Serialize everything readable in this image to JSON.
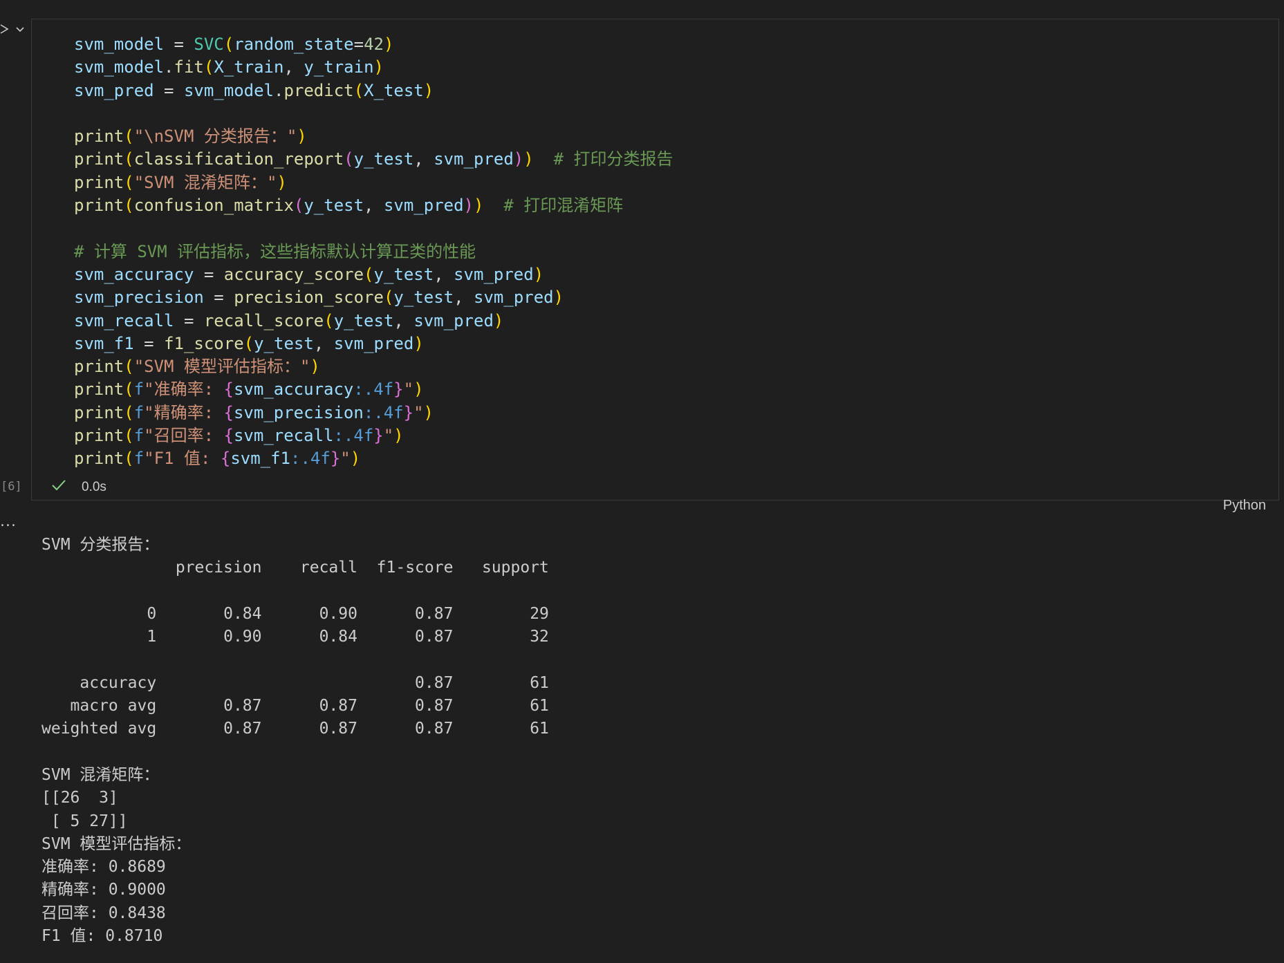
{
  "cell": {
    "execution_count": "[6]",
    "exec_time": "0.0s",
    "language": "Python",
    "code_lines": [
      [
        {
          "t": "svm_model",
          "c": "v"
        },
        {
          "t": " = "
        },
        {
          "t": "SVC",
          "c": "c"
        },
        {
          "t": "(",
          "c": "b1"
        },
        {
          "t": "random_state",
          "c": "v"
        },
        {
          "t": "="
        },
        {
          "t": "42",
          "c": "n"
        },
        {
          "t": ")",
          "c": "b1"
        }
      ],
      [
        {
          "t": "svm_model",
          "c": "v"
        },
        {
          "t": "."
        },
        {
          "t": "fit",
          "c": "f"
        },
        {
          "t": "(",
          "c": "b1"
        },
        {
          "t": "X_train",
          "c": "v"
        },
        {
          "t": ", "
        },
        {
          "t": "y_train",
          "c": "v"
        },
        {
          "t": ")",
          "c": "b1"
        }
      ],
      [
        {
          "t": "svm_pred",
          "c": "v"
        },
        {
          "t": " = "
        },
        {
          "t": "svm_model",
          "c": "v"
        },
        {
          "t": "."
        },
        {
          "t": "predict",
          "c": "f"
        },
        {
          "t": "(",
          "c": "b1"
        },
        {
          "t": "X_test",
          "c": "v"
        },
        {
          "t": ")",
          "c": "b1"
        }
      ],
      [],
      [
        {
          "t": "print",
          "c": "f"
        },
        {
          "t": "(",
          "c": "b1"
        },
        {
          "t": "\"\\nSVM 分类报告：\"",
          "c": "s"
        },
        {
          "t": ")",
          "c": "b1"
        }
      ],
      [
        {
          "t": "print",
          "c": "f"
        },
        {
          "t": "(",
          "c": "b1"
        },
        {
          "t": "classification_report",
          "c": "f"
        },
        {
          "t": "(",
          "c": "b2"
        },
        {
          "t": "y_test",
          "c": "v"
        },
        {
          "t": ", "
        },
        {
          "t": "svm_pred",
          "c": "v"
        },
        {
          "t": ")",
          "c": "b2"
        },
        {
          "t": ")",
          "c": "b1"
        },
        {
          "t": "  "
        },
        {
          "t": "# 打印分类报告",
          "c": "cm"
        }
      ],
      [
        {
          "t": "print",
          "c": "f"
        },
        {
          "t": "(",
          "c": "b1"
        },
        {
          "t": "\"SVM 混淆矩阵：\"",
          "c": "s"
        },
        {
          "t": ")",
          "c": "b1"
        }
      ],
      [
        {
          "t": "print",
          "c": "f"
        },
        {
          "t": "(",
          "c": "b1"
        },
        {
          "t": "confusion_matrix",
          "c": "f"
        },
        {
          "t": "(",
          "c": "b2"
        },
        {
          "t": "y_test",
          "c": "v"
        },
        {
          "t": ", "
        },
        {
          "t": "svm_pred",
          "c": "v"
        },
        {
          "t": ")",
          "c": "b2"
        },
        {
          "t": ")",
          "c": "b1"
        },
        {
          "t": "  "
        },
        {
          "t": "# 打印混淆矩阵",
          "c": "cm"
        }
      ],
      [],
      [
        {
          "t": "# 计算 SVM 评估指标，这些指标默认计算正类的性能",
          "c": "cm"
        }
      ],
      [
        {
          "t": "svm_accuracy",
          "c": "v"
        },
        {
          "t": " = "
        },
        {
          "t": "accuracy_score",
          "c": "f"
        },
        {
          "t": "(",
          "c": "b1"
        },
        {
          "t": "y_test",
          "c": "v"
        },
        {
          "t": ", "
        },
        {
          "t": "svm_pred",
          "c": "v"
        },
        {
          "t": ")",
          "c": "b1"
        }
      ],
      [
        {
          "t": "svm_precision",
          "c": "v"
        },
        {
          "t": " = "
        },
        {
          "t": "precision_score",
          "c": "f"
        },
        {
          "t": "(",
          "c": "b1"
        },
        {
          "t": "y_test",
          "c": "v"
        },
        {
          "t": ", "
        },
        {
          "t": "svm_pred",
          "c": "v"
        },
        {
          "t": ")",
          "c": "b1"
        }
      ],
      [
        {
          "t": "svm_recall",
          "c": "v"
        },
        {
          "t": " = "
        },
        {
          "t": "recall_score",
          "c": "f"
        },
        {
          "t": "(",
          "c": "b1"
        },
        {
          "t": "y_test",
          "c": "v"
        },
        {
          "t": ", "
        },
        {
          "t": "svm_pred",
          "c": "v"
        },
        {
          "t": ")",
          "c": "b1"
        }
      ],
      [
        {
          "t": "svm_f1",
          "c": "v"
        },
        {
          "t": " = "
        },
        {
          "t": "f1_score",
          "c": "f"
        },
        {
          "t": "(",
          "c": "b1"
        },
        {
          "t": "y_test",
          "c": "v"
        },
        {
          "t": ", "
        },
        {
          "t": "svm_pred",
          "c": "v"
        },
        {
          "t": ")",
          "c": "b1"
        }
      ],
      [
        {
          "t": "print",
          "c": "f"
        },
        {
          "t": "(",
          "c": "b1"
        },
        {
          "t": "\"SVM 模型评估指标：\"",
          "c": "s"
        },
        {
          "t": ")",
          "c": "b1"
        }
      ],
      [
        {
          "t": "print",
          "c": "f"
        },
        {
          "t": "(",
          "c": "b1"
        },
        {
          "t": "f",
          "c": "k"
        },
        {
          "t": "\"准确率: ",
          "c": "s"
        },
        {
          "t": "{",
          "c": "b2"
        },
        {
          "t": "svm_accuracy",
          "c": "v"
        },
        {
          "t": ":.4f",
          "c": "k"
        },
        {
          "t": "}",
          "c": "b2"
        },
        {
          "t": "\"",
          "c": "s"
        },
        {
          "t": ")",
          "c": "b1"
        }
      ],
      [
        {
          "t": "print",
          "c": "f"
        },
        {
          "t": "(",
          "c": "b1"
        },
        {
          "t": "f",
          "c": "k"
        },
        {
          "t": "\"精确率: ",
          "c": "s"
        },
        {
          "t": "{",
          "c": "b2"
        },
        {
          "t": "svm_precision",
          "c": "v"
        },
        {
          "t": ":.4f",
          "c": "k"
        },
        {
          "t": "}",
          "c": "b2"
        },
        {
          "t": "\"",
          "c": "s"
        },
        {
          "t": ")",
          "c": "b1"
        }
      ],
      [
        {
          "t": "print",
          "c": "f"
        },
        {
          "t": "(",
          "c": "b1"
        },
        {
          "t": "f",
          "c": "k"
        },
        {
          "t": "\"召回率: ",
          "c": "s"
        },
        {
          "t": "{",
          "c": "b2"
        },
        {
          "t": "svm_recall",
          "c": "v"
        },
        {
          "t": ":.4f",
          "c": "k"
        },
        {
          "t": "}",
          "c": "b2"
        },
        {
          "t": "\"",
          "c": "s"
        },
        {
          "t": ")",
          "c": "b1"
        }
      ],
      [
        {
          "t": "print",
          "c": "f"
        },
        {
          "t": "(",
          "c": "b1"
        },
        {
          "t": "f",
          "c": "k"
        },
        {
          "t": "\"F1 值: ",
          "c": "s"
        },
        {
          "t": "{",
          "c": "b2"
        },
        {
          "t": "svm_f1",
          "c": "v"
        },
        {
          "t": ":.4f",
          "c": "k"
        },
        {
          "t": "}",
          "c": "b2"
        },
        {
          "t": "\"",
          "c": "s"
        },
        {
          "t": ")",
          "c": "b1"
        }
      ]
    ]
  },
  "output": {
    "more_label": "...",
    "lines": [
      "SVM 分类报告：",
      "              precision    recall  f1-score   support",
      "",
      "           0       0.84      0.90      0.87        29",
      "           1       0.90      0.84      0.87        32",
      "",
      "    accuracy                           0.87        61",
      "   macro avg       0.87      0.87      0.87        61",
      "weighted avg       0.87      0.87      0.87        61",
      "",
      "SVM 混淆矩阵：",
      "[[26  3]",
      " [ 5 27]]",
      "SVM 模型评估指标：",
      "准确率: 0.8689",
      "精确率: 0.9000",
      "召回率: 0.8438",
      "F1 值: 0.8710"
    ]
  }
}
